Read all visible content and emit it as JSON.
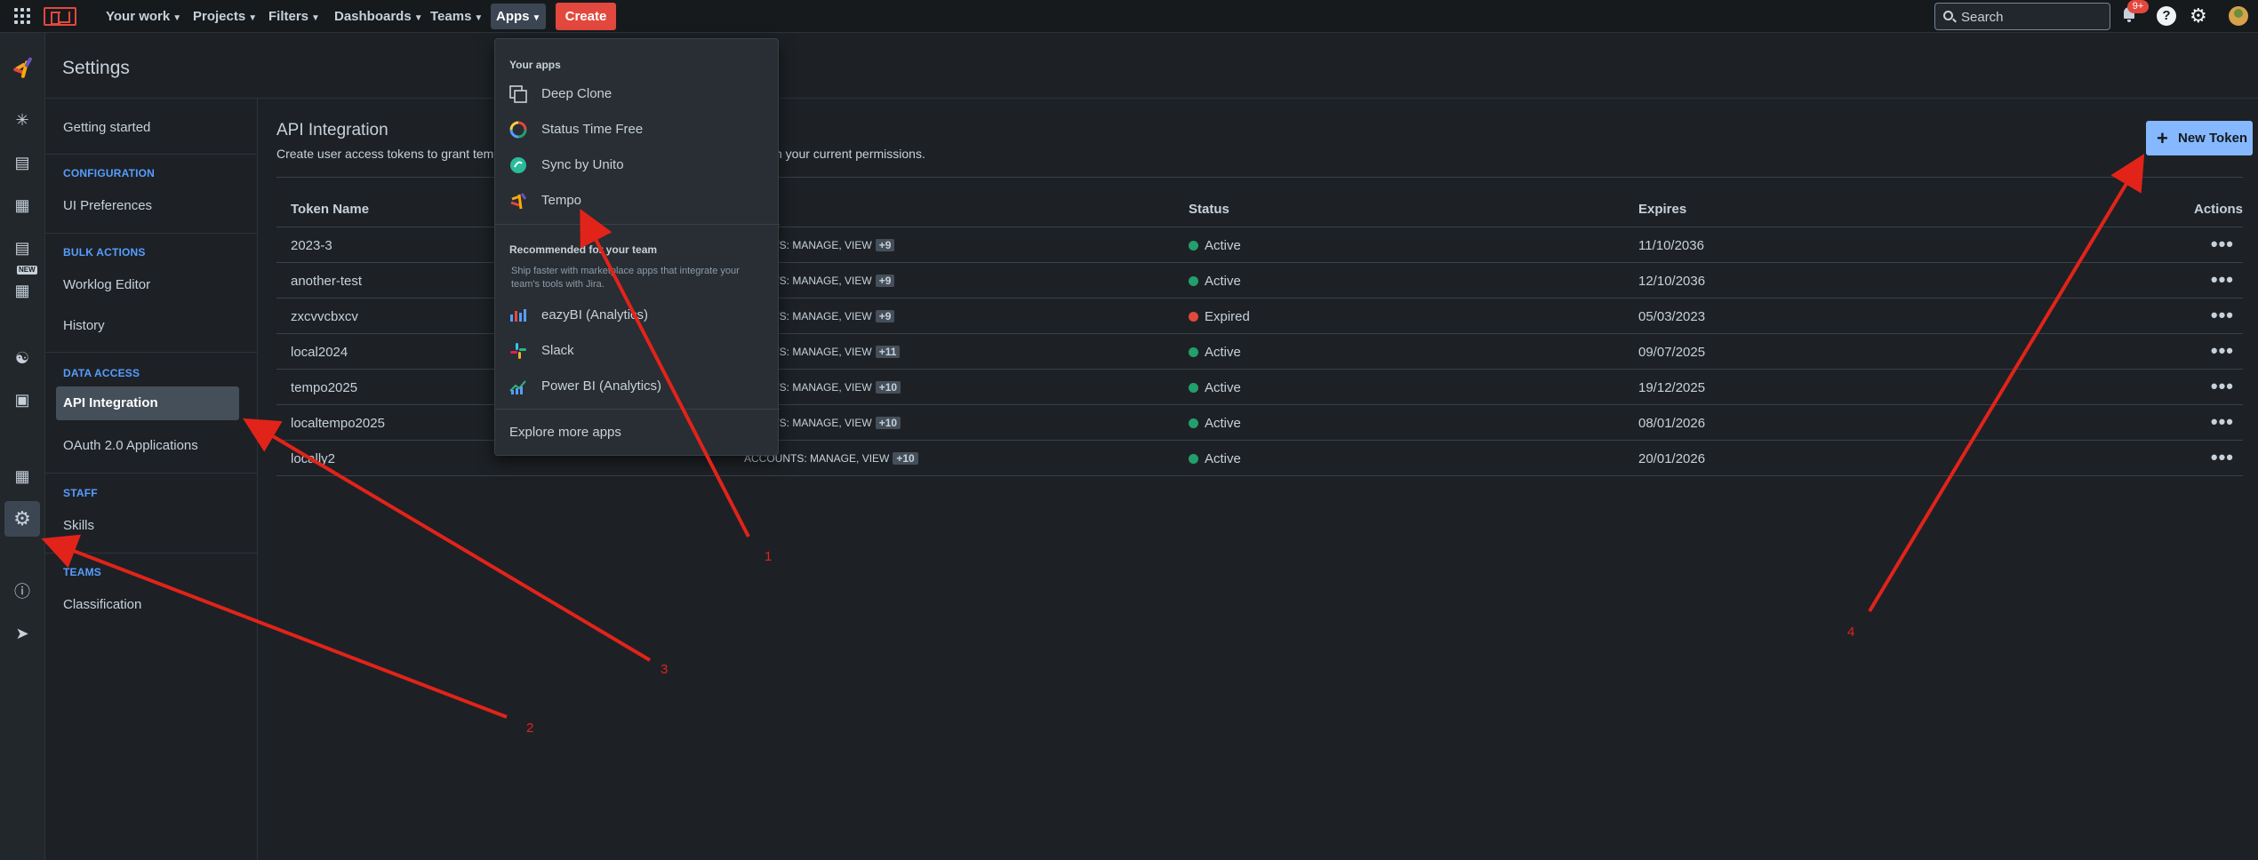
{
  "topbar": {
    "nav": [
      "Your work",
      "Projects",
      "Filters",
      "Dashboards",
      "Teams",
      "Apps"
    ],
    "create_label": "Create",
    "search_placeholder": "Search",
    "notifications_badge": "9+",
    "help_glyph": "?"
  },
  "page": {
    "title": "Settings"
  },
  "sidebar": {
    "getting_started": "Getting started",
    "sections": [
      {
        "heading": "CONFIGURATION",
        "items": [
          "UI Preferences"
        ]
      },
      {
        "heading": "BULK ACTIONS",
        "items": [
          "Worklog Editor",
          "History"
        ]
      },
      {
        "heading": "DATA ACCESS",
        "items": [
          "API Integration",
          "OAuth 2.0 Applications"
        ]
      },
      {
        "heading": "STAFF",
        "items": [
          "Skills"
        ]
      },
      {
        "heading": "TEAMS",
        "items": [
          "Classification"
        ]
      }
    ]
  },
  "rail": {
    "new_tag": "NEW"
  },
  "main": {
    "title": "API Integration",
    "desc_left": "Create user access tokens to grant tem",
    "desc_right": "n your current permissions.",
    "new_token_label": "New Token",
    "columns": {
      "name": "Token Name",
      "status": "Status",
      "expires": "Expires",
      "actions": "Actions"
    },
    "rows": [
      {
        "name": "2023-3",
        "perm_prefix": "UNTS",
        "perm": "MANAGE, VIEW",
        "extra": "+9",
        "status": "Active",
        "expires": "11/10/2036"
      },
      {
        "name": "another-test",
        "perm_prefix": "UNTS",
        "perm": "MANAGE, VIEW",
        "extra": "+9",
        "status": "Active",
        "expires": "12/10/2036"
      },
      {
        "name": "zxcvvcbxcv",
        "perm_prefix": "UNTS",
        "perm": "MANAGE, VIEW",
        "extra": "+9",
        "status": "Expired",
        "expires": "05/03/2023"
      },
      {
        "name": "local2024",
        "perm_prefix": "UNTS",
        "perm": "MANAGE, VIEW",
        "extra": "+11",
        "status": "Active",
        "expires": "09/07/2025"
      },
      {
        "name": "tempo2025",
        "perm_prefix": "UNTS",
        "perm": "MANAGE, VIEW",
        "extra": "+10",
        "status": "Active",
        "expires": "19/12/2025"
      },
      {
        "name": "localtempo2025",
        "perm_prefix": "UNTS",
        "perm": "MANAGE, VIEW",
        "extra": "+10",
        "status": "Active",
        "expires": "08/01/2026"
      },
      {
        "name": "locally2",
        "perm_prefix": "ACCOUNTS",
        "perm": "MANAGE, VIEW",
        "extra": "+10",
        "status": "Active",
        "expires": "20/01/2026"
      }
    ],
    "actions_glyph": "•••"
  },
  "apps_menu": {
    "your_apps_heading": "Your apps",
    "your_apps": [
      "Deep Clone",
      "Status Time Free",
      "Sync by Unito",
      "Tempo"
    ],
    "recommended_heading": "Recommended for your team",
    "recommended_desc": "Ship faster with marketplace apps that integrate your team's tools with Jira.",
    "recommended": [
      "eazyBI (Analytics)",
      "Slack",
      "Power BI (Analytics)"
    ],
    "explore": "Explore more apps"
  },
  "annotations": [
    "1",
    "2",
    "3",
    "4"
  ],
  "colors": {
    "active": "#22a06b",
    "expired": "#e2483d",
    "annotation": "#e2231a",
    "accent": "#85b8ff"
  }
}
